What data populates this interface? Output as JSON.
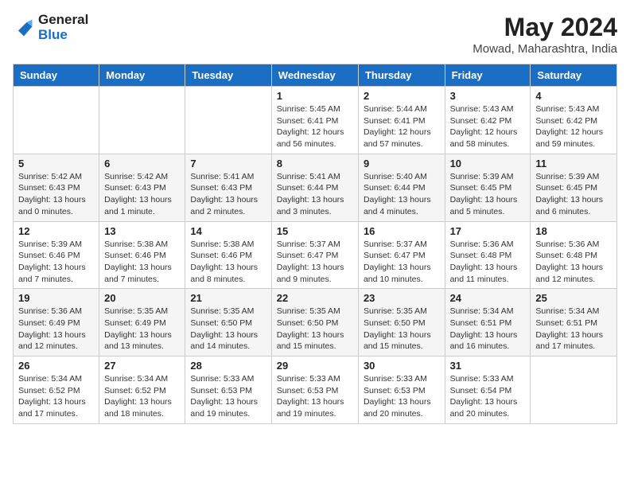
{
  "header": {
    "logo_line1": "General",
    "logo_line2": "Blue",
    "month_year": "May 2024",
    "location": "Mowad, Maharashtra, India"
  },
  "days_of_week": [
    "Sunday",
    "Monday",
    "Tuesday",
    "Wednesday",
    "Thursday",
    "Friday",
    "Saturday"
  ],
  "weeks": [
    [
      {
        "day": "",
        "info": ""
      },
      {
        "day": "",
        "info": ""
      },
      {
        "day": "",
        "info": ""
      },
      {
        "day": "1",
        "info": "Sunrise: 5:45 AM\nSunset: 6:41 PM\nDaylight: 12 hours\nand 56 minutes."
      },
      {
        "day": "2",
        "info": "Sunrise: 5:44 AM\nSunset: 6:41 PM\nDaylight: 12 hours\nand 57 minutes."
      },
      {
        "day": "3",
        "info": "Sunrise: 5:43 AM\nSunset: 6:42 PM\nDaylight: 12 hours\nand 58 minutes."
      },
      {
        "day": "4",
        "info": "Sunrise: 5:43 AM\nSunset: 6:42 PM\nDaylight: 12 hours\nand 59 minutes."
      }
    ],
    [
      {
        "day": "5",
        "info": "Sunrise: 5:42 AM\nSunset: 6:43 PM\nDaylight: 13 hours\nand 0 minutes."
      },
      {
        "day": "6",
        "info": "Sunrise: 5:42 AM\nSunset: 6:43 PM\nDaylight: 13 hours\nand 1 minute."
      },
      {
        "day": "7",
        "info": "Sunrise: 5:41 AM\nSunset: 6:43 PM\nDaylight: 13 hours\nand 2 minutes."
      },
      {
        "day": "8",
        "info": "Sunrise: 5:41 AM\nSunset: 6:44 PM\nDaylight: 13 hours\nand 3 minutes."
      },
      {
        "day": "9",
        "info": "Sunrise: 5:40 AM\nSunset: 6:44 PM\nDaylight: 13 hours\nand 4 minutes."
      },
      {
        "day": "10",
        "info": "Sunrise: 5:39 AM\nSunset: 6:45 PM\nDaylight: 13 hours\nand 5 minutes."
      },
      {
        "day": "11",
        "info": "Sunrise: 5:39 AM\nSunset: 6:45 PM\nDaylight: 13 hours\nand 6 minutes."
      }
    ],
    [
      {
        "day": "12",
        "info": "Sunrise: 5:39 AM\nSunset: 6:46 PM\nDaylight: 13 hours\nand 7 minutes."
      },
      {
        "day": "13",
        "info": "Sunrise: 5:38 AM\nSunset: 6:46 PM\nDaylight: 13 hours\nand 7 minutes."
      },
      {
        "day": "14",
        "info": "Sunrise: 5:38 AM\nSunset: 6:46 PM\nDaylight: 13 hours\nand 8 minutes."
      },
      {
        "day": "15",
        "info": "Sunrise: 5:37 AM\nSunset: 6:47 PM\nDaylight: 13 hours\nand 9 minutes."
      },
      {
        "day": "16",
        "info": "Sunrise: 5:37 AM\nSunset: 6:47 PM\nDaylight: 13 hours\nand 10 minutes."
      },
      {
        "day": "17",
        "info": "Sunrise: 5:36 AM\nSunset: 6:48 PM\nDaylight: 13 hours\nand 11 minutes."
      },
      {
        "day": "18",
        "info": "Sunrise: 5:36 AM\nSunset: 6:48 PM\nDaylight: 13 hours\nand 12 minutes."
      }
    ],
    [
      {
        "day": "19",
        "info": "Sunrise: 5:36 AM\nSunset: 6:49 PM\nDaylight: 13 hours\nand 12 minutes."
      },
      {
        "day": "20",
        "info": "Sunrise: 5:35 AM\nSunset: 6:49 PM\nDaylight: 13 hours\nand 13 minutes."
      },
      {
        "day": "21",
        "info": "Sunrise: 5:35 AM\nSunset: 6:50 PM\nDaylight: 13 hours\nand 14 minutes."
      },
      {
        "day": "22",
        "info": "Sunrise: 5:35 AM\nSunset: 6:50 PM\nDaylight: 13 hours\nand 15 minutes."
      },
      {
        "day": "23",
        "info": "Sunrise: 5:35 AM\nSunset: 6:50 PM\nDaylight: 13 hours\nand 15 minutes."
      },
      {
        "day": "24",
        "info": "Sunrise: 5:34 AM\nSunset: 6:51 PM\nDaylight: 13 hours\nand 16 minutes."
      },
      {
        "day": "25",
        "info": "Sunrise: 5:34 AM\nSunset: 6:51 PM\nDaylight: 13 hours\nand 17 minutes."
      }
    ],
    [
      {
        "day": "26",
        "info": "Sunrise: 5:34 AM\nSunset: 6:52 PM\nDaylight: 13 hours\nand 17 minutes."
      },
      {
        "day": "27",
        "info": "Sunrise: 5:34 AM\nSunset: 6:52 PM\nDaylight: 13 hours\nand 18 minutes."
      },
      {
        "day": "28",
        "info": "Sunrise: 5:33 AM\nSunset: 6:53 PM\nDaylight: 13 hours\nand 19 minutes."
      },
      {
        "day": "29",
        "info": "Sunrise: 5:33 AM\nSunset: 6:53 PM\nDaylight: 13 hours\nand 19 minutes."
      },
      {
        "day": "30",
        "info": "Sunrise: 5:33 AM\nSunset: 6:53 PM\nDaylight: 13 hours\nand 20 minutes."
      },
      {
        "day": "31",
        "info": "Sunrise: 5:33 AM\nSunset: 6:54 PM\nDaylight: 13 hours\nand 20 minutes."
      },
      {
        "day": "",
        "info": ""
      }
    ]
  ]
}
